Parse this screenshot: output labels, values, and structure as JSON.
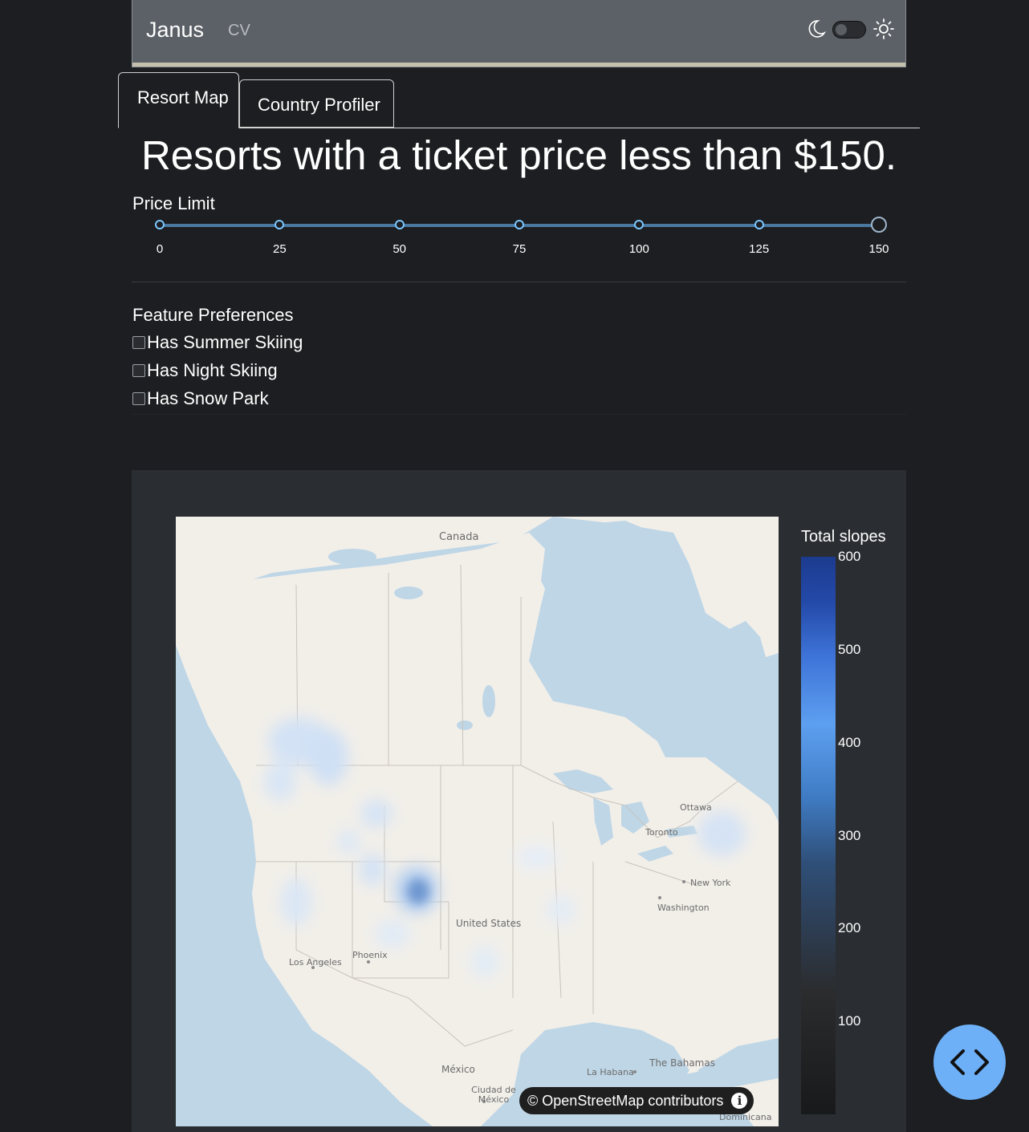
{
  "navbar": {
    "brand": "Janus",
    "links": [
      "CV"
    ],
    "theme_toggle": {
      "state": "dark"
    }
  },
  "tabs": [
    {
      "label": "Resort Map",
      "active": true
    },
    {
      "label": "Country Profiler",
      "active": false
    }
  ],
  "headline": "Resorts with a ticket price less than $150.",
  "price_filter": {
    "label": "Price Limit",
    "marks": [
      "0",
      "25",
      "50",
      "75",
      "100",
      "125",
      "150"
    ],
    "min": 0,
    "max": 150,
    "value": 150
  },
  "features": {
    "title": "Feature Preferences",
    "options": [
      {
        "label": "Has Summer Skiing",
        "checked": false
      },
      {
        "label": "Has Night Skiing",
        "checked": false
      },
      {
        "label": "Has Snow Park",
        "checked": false
      }
    ]
  },
  "map": {
    "labels": [
      "Canada",
      "Ottawa",
      "Toronto",
      "New York",
      "Washington",
      "United States",
      "Phoenix",
      "Los Angeles",
      "México",
      "Ciudad de México",
      "La Habana",
      "The Bahamas",
      "Dominicana"
    ],
    "attribution": {
      "symbol": "©",
      "source": "OpenStreetMap",
      "suffix": "contributors",
      "info_icon": "info-icon"
    }
  },
  "chart_data": {
    "type": "heatmap",
    "colorbar": {
      "title": "Total slopes",
      "ticks": [
        "600",
        "500",
        "400",
        "300",
        "200",
        "100"
      ],
      "range": [
        0,
        600
      ],
      "colors": [
        "#18191b",
        "#2f4f78",
        "#5d9ff0",
        "#1c3b8f"
      ]
    }
  },
  "fab": {
    "icon": "code-icon"
  },
  "colors": {
    "background": "#1c1e21",
    "navbar": "#5c6167",
    "accent": "#7bc6ff",
    "fab": "#6eb0f7"
  }
}
